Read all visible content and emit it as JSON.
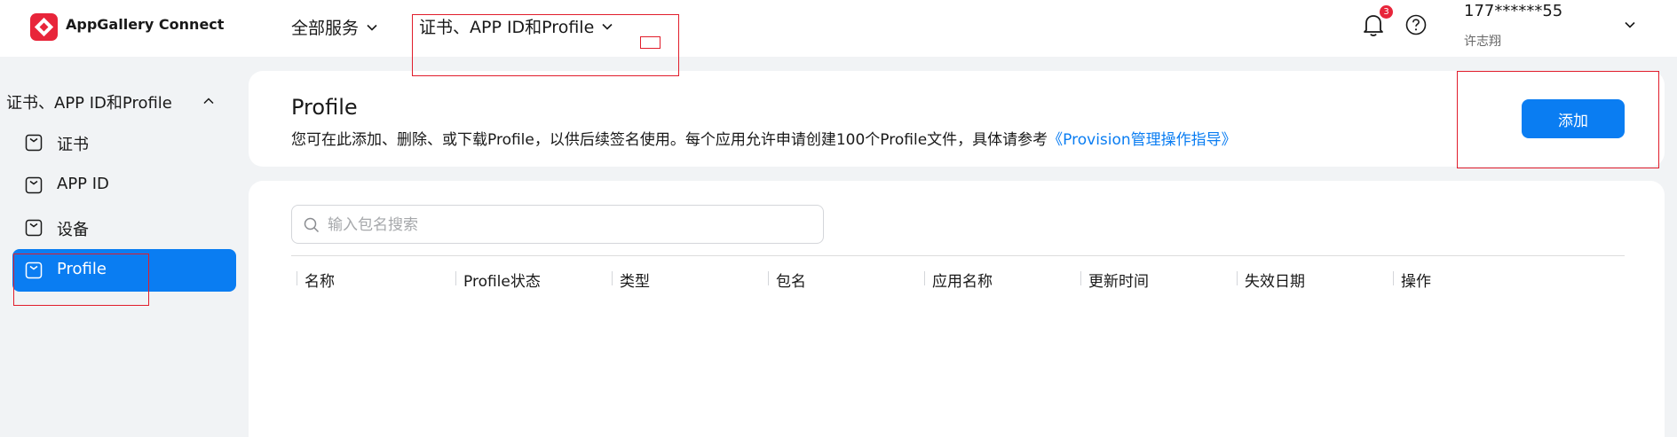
{
  "topbar": {
    "app_name": "AppGallery Connect",
    "nav_all": "全部服务",
    "nav_current": "证书、APP ID和Profile",
    "notification_count": "3",
    "user_phone": "177******55",
    "user_name": "许志翔",
    "icons": {
      "logo": "appgallery-logo-icon",
      "bell": "bell-icon",
      "help": "help-icon",
      "chevron": "chevron-down-icon"
    }
  },
  "sidebar": {
    "header": "证书、APP ID和Profile",
    "items": [
      {
        "label": "证书",
        "icon": "document-icon",
        "active": false
      },
      {
        "label": "APP ID",
        "icon": "document-icon",
        "active": false
      },
      {
        "label": "设备",
        "icon": "document-icon",
        "active": false
      },
      {
        "label": "Profile",
        "icon": "document-icon",
        "active": true
      }
    ]
  },
  "page": {
    "title": "Profile",
    "description": "您可在此添加、删除、或下载Profile，以供后续签名使用。每个应用允许申请创建100个Profile文件，具体请参考",
    "guide_link": "《Provision管理操作指导》",
    "add_button": "添加"
  },
  "search": {
    "placeholder": "输入包名搜索",
    "value": ""
  },
  "table": {
    "columns": [
      "名称",
      "Profile状态",
      "类型",
      "包名",
      "应用名称",
      "更新时间",
      "失效日期",
      "操作"
    ],
    "rows": []
  },
  "colors": {
    "accent": "#0a7df2",
    "brand": "#e8253a",
    "annotation": "#e11d2b"
  }
}
